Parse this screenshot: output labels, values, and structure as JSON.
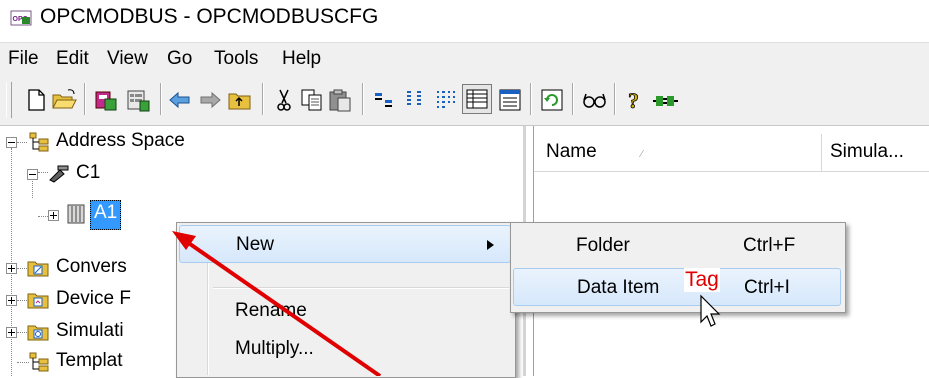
{
  "window": {
    "title": "OPCMODBUS - OPCMODBUSCFG",
    "app_icon": "opc-app-icon"
  },
  "menubar": {
    "items": [
      "File",
      "Edit",
      "View",
      "Go",
      "Tools",
      "Help"
    ]
  },
  "toolbar": {
    "buttons": [
      "new-file-icon",
      "open-folder-icon",
      "new-device-icon",
      "properties-icon",
      "back-icon",
      "forward-icon",
      "up-folder-icon",
      "cut-icon",
      "copy-icon",
      "paste-icon",
      "large-icons-view-icon",
      "small-icons-view-icon",
      "list-view-icon",
      "details-view-icon",
      "sheet-view-icon",
      "refresh-icon",
      "glasses-icon",
      "help-icon",
      "connect-icon"
    ]
  },
  "tree": {
    "root": {
      "label": "Address Space"
    },
    "c1": {
      "label": "C1"
    },
    "a1": {
      "label": "A1"
    },
    "conversions": {
      "label": "Convers"
    },
    "device": {
      "label": "Device F"
    },
    "simulation": {
      "label": "Simulati"
    },
    "templates": {
      "label": "Templat"
    }
  },
  "list": {
    "columns": [
      "Name",
      "Simula..."
    ]
  },
  "context_menu": {
    "items": [
      {
        "label": "New",
        "has_submenu": true,
        "highlighted": true
      },
      {
        "label": "Rename"
      },
      {
        "label": "Multiply..."
      }
    ]
  },
  "submenu": {
    "items": [
      {
        "label": "Folder",
        "shortcut": "Ctrl+F"
      },
      {
        "label": "Data Item",
        "shortcut": "Ctrl+I",
        "highlighted": true
      }
    ]
  },
  "annotation": {
    "text": "Tag",
    "color": "#e00000"
  },
  "colors": {
    "highlight": "#3399ff",
    "arrow": "#e00000",
    "menu_bg": "#f0f0f0"
  }
}
